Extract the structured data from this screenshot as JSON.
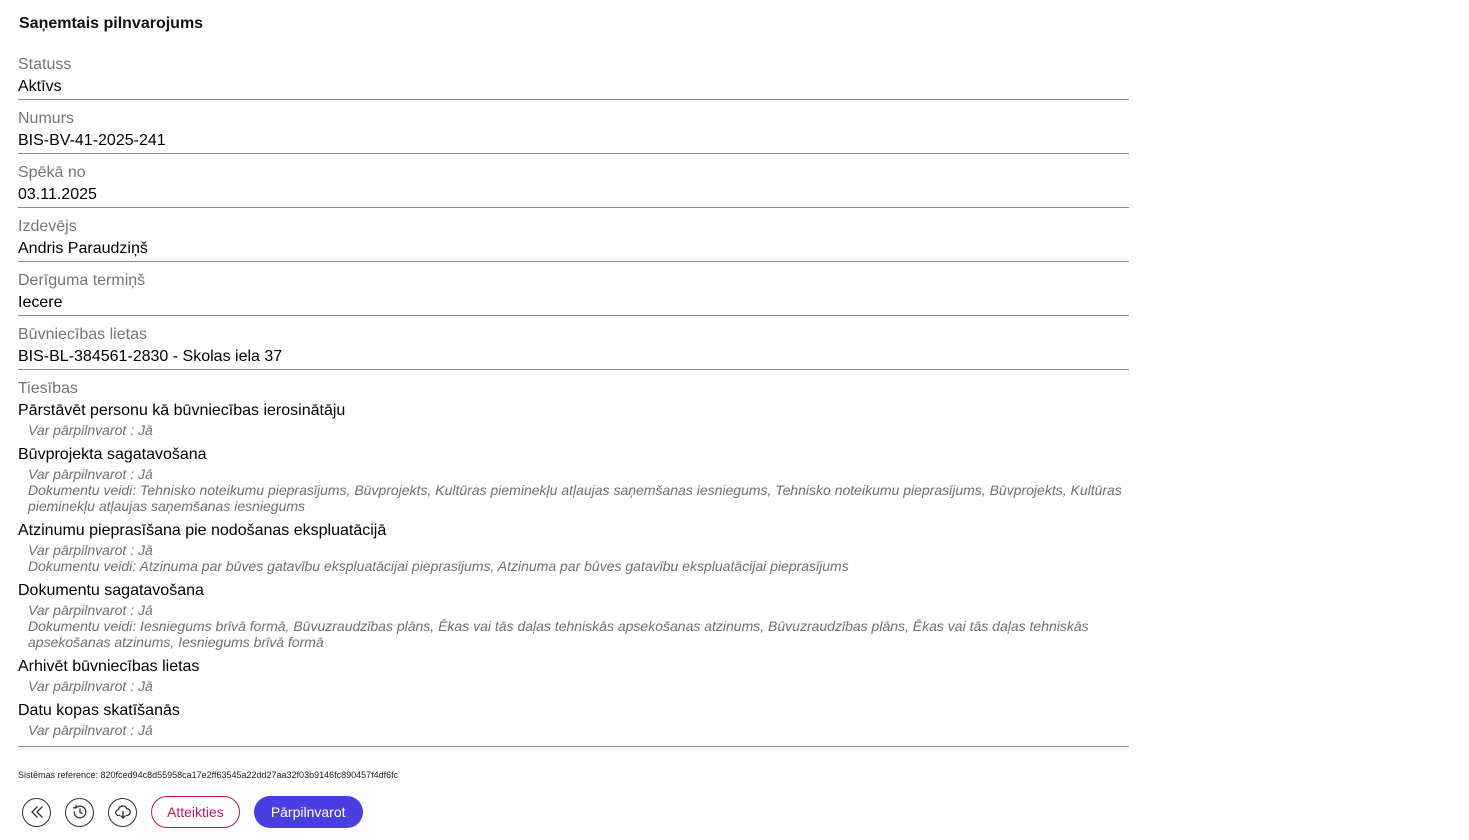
{
  "page": {
    "title": "Saņemtais pilnvarojums"
  },
  "fields": [
    {
      "label": "Statuss",
      "value": "Aktīvs"
    },
    {
      "label": "Numurs",
      "value": "BIS-BV-41-2025-241"
    },
    {
      "label": "Spēkā no",
      "value": "03.11.2025"
    },
    {
      "label": "Izdevējs",
      "value": "Andris Paraudziņš"
    },
    {
      "label": "Derīguma termiņš",
      "value": "Iecere"
    },
    {
      "label": "Būvniecības lietas",
      "value": "BIS-BL-384561-2830 - Skolas iela 37"
    }
  ],
  "rights": {
    "label": "Tiesības",
    "items": [
      {
        "title": "Pārstāvēt personu kā būvniecības ierosinātāju",
        "subpower": "Var pārpilnvarot : Jā"
      },
      {
        "title": "Būvprojekta sagatavošana",
        "subpower": "Var pārpilnvarot : Jā",
        "doc_types": "Dokumentu veidi: Tehnisko noteikumu pieprasījums, Būvprojekts, Kultūras pieminekļu atļaujas saņemšanas iesniegums, Tehnisko noteikumu pieprasījums, Būvprojekts, Kultūras pieminekļu atļaujas saņemšanas iesniegums"
      },
      {
        "title": "Atzinumu pieprasīšana pie nodošanas ekspluatācijā",
        "subpower": "Var pārpilnvarot : Jā",
        "doc_types": "Dokumentu veidi: Atzinuma par būves gatavību ekspluatācijai pieprasījums, Atzinuma par būves gatavību ekspluatācijai pieprasījums"
      },
      {
        "title": "Dokumentu sagatavošana",
        "subpower": "Var pārpilnvarot : Jā",
        "doc_types": "Dokumentu veidi: Iesniegums brīvā formā, Būvuzraudzības plāns, Ēkas vai tās daļas tehniskās apsekošanas atzinums, Būvuzraudzības plāns, Ēkas vai tās daļas tehniskās apsekošanas atzinums, Iesniegums brīvā formā"
      },
      {
        "title": "Arhivēt būvniecības lietas",
        "subpower": "Var pārpilnvarot : Jā"
      },
      {
        "title": "Datu kopas skatīšanās",
        "subpower": "Var pārpilnvarot : Jā"
      }
    ]
  },
  "system_reference": "Sistēmas reference: 820fced94c8d55958ca17e2ff63545a22dd27aa32f03b9146fc890457f4df6fc",
  "actions": {
    "back_icon": "double-chevron-left-icon",
    "history_icon": "history-icon",
    "download_icon": "cloud-download-icon",
    "decline_label": "Atteikties",
    "redelegate_label": "Pārpilnvarot"
  },
  "colors": {
    "primary": "#4b3ee0",
    "decline": "#c2185b",
    "label_gray": "#767676",
    "divider": "#8c8c8c"
  }
}
